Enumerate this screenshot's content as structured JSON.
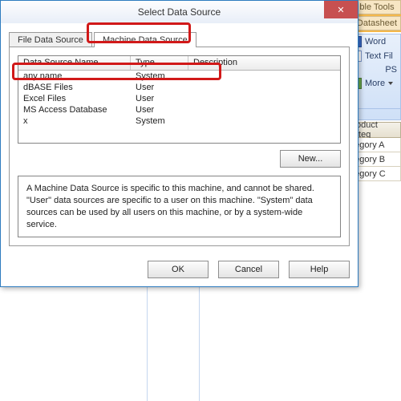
{
  "dialog": {
    "title": "Select Data Source",
    "close_glyph": "✕",
    "tabs": {
      "file": "File Data Source",
      "machine": "Machine Data Source"
    },
    "grid": {
      "headers": {
        "name": "Data Source Name",
        "type": "Type",
        "desc": "Description"
      },
      "rows": [
        {
          "name": "any name",
          "type": "System",
          "desc": ""
        },
        {
          "name": "dBASE Files",
          "type": "User",
          "desc": ""
        },
        {
          "name": "Excel Files",
          "type": "User",
          "desc": ""
        },
        {
          "name": "MS Access Database",
          "type": "User",
          "desc": ""
        },
        {
          "name": "x",
          "type": "System",
          "desc": ""
        }
      ]
    },
    "new_btn": "New...",
    "info": "A Machine Data Source is specific to this machine, and cannot be shared. \"User\" data sources are specific to a user on this machine.  \"System\" data sources can be used by all users on this machine, or by a system-wide service.",
    "ok": "OK",
    "cancel": "Cancel",
    "help": "Help"
  },
  "bg": {
    "ribbon_tab": "ble Tools",
    "ribbon_sub": "Datasheet",
    "items": {
      "word": "Word",
      "text": "Text Fil",
      "more": "More",
      "ps": "PS"
    },
    "col_header": "Product Categ",
    "cells": [
      "ategory A",
      "ategory B",
      "ategory C"
    ]
  }
}
